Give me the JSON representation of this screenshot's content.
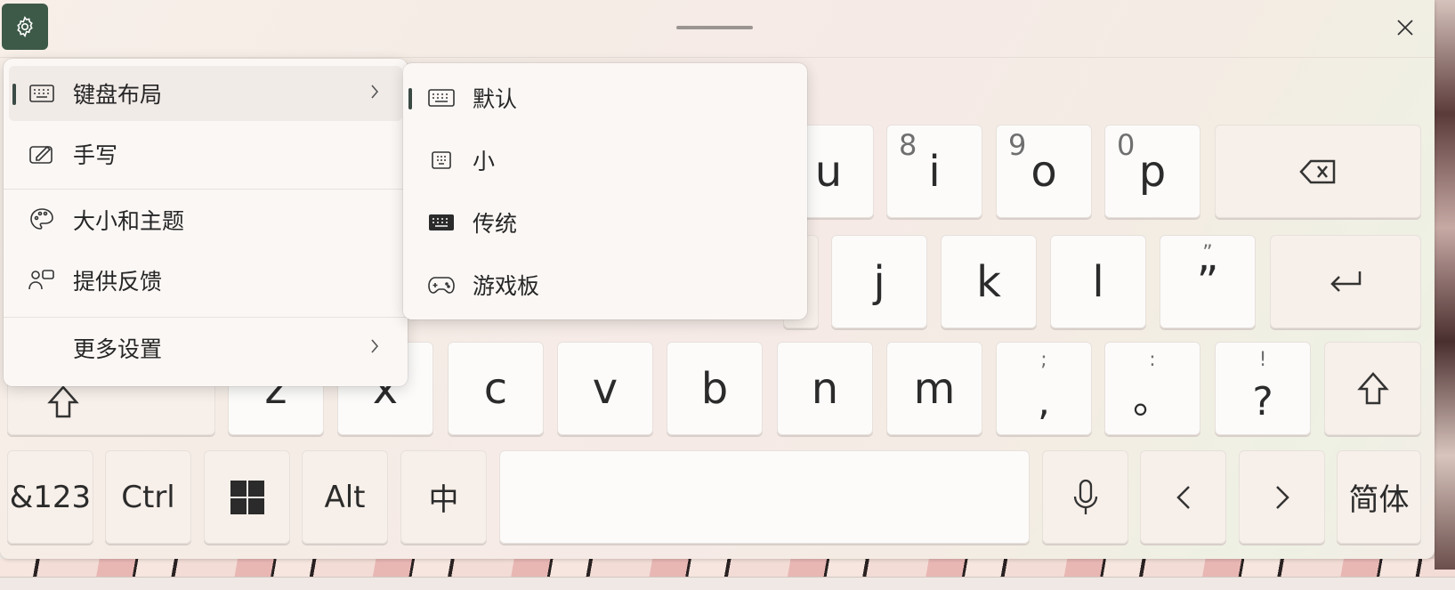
{
  "menu_main": {
    "items": [
      {
        "label": "键盘布局",
        "icon": "keyboard-icon",
        "has_submenu": true,
        "active": true
      },
      {
        "label": "手写",
        "icon": "handwriting-icon"
      },
      {
        "label": "大小和主题",
        "icon": "palette-icon"
      },
      {
        "label": "提供反馈",
        "icon": "feedback-icon"
      },
      {
        "label": "更多设置",
        "icon": "",
        "has_submenu": true
      }
    ]
  },
  "menu_sub": {
    "items": [
      {
        "label": "默认",
        "icon": "keyboard-default-icon",
        "selected": true
      },
      {
        "label": "小",
        "icon": "keyboard-small-icon"
      },
      {
        "label": "传统",
        "icon": "keyboard-traditional-icon"
      },
      {
        "label": "游戏板",
        "icon": "gamepad-icon"
      }
    ]
  },
  "keys": {
    "row1": [
      {
        "main": "u"
      },
      {
        "main": "i",
        "sub": "8"
      },
      {
        "main": "o",
        "sub": "9"
      },
      {
        "main": "p",
        "sub": "0"
      },
      {
        "name": "backspace",
        "icon": "backspace-icon"
      }
    ],
    "row2": [
      {
        "main": "j"
      },
      {
        "main": "k"
      },
      {
        "main": "l"
      },
      {
        "main": "”",
        "top": "”"
      },
      {
        "name": "enter",
        "icon": "enter-icon"
      }
    ],
    "row3": [
      {
        "name": "shift-left",
        "icon": "shift-icon"
      },
      {
        "main": "z"
      },
      {
        "main": "x"
      },
      {
        "main": "c"
      },
      {
        "main": "v"
      },
      {
        "main": "b"
      },
      {
        "main": "n"
      },
      {
        "main": "m"
      },
      {
        "main": ",",
        "top": ";"
      },
      {
        "main": "。",
        "top": ":"
      },
      {
        "main": "?",
        "top": "!"
      },
      {
        "name": "shift-right",
        "icon": "shift-icon"
      }
    ],
    "row4": [
      {
        "label": "&123"
      },
      {
        "label": "Ctrl"
      },
      {
        "name": "windows",
        "icon": "windows-icon"
      },
      {
        "label": "Alt"
      },
      {
        "label": "中"
      },
      {
        "name": "space"
      },
      {
        "name": "microphone",
        "icon": "microphone-icon"
      },
      {
        "name": "left",
        "icon": "chevron-left-icon"
      },
      {
        "name": "right",
        "icon": "chevron-right-icon"
      },
      {
        "label": "简体"
      }
    ]
  },
  "colors": {
    "settings_button_bg": "#3d5a48",
    "key_bg": "#fcfbfa",
    "menu_bg": "#fbf7f5",
    "active_indicator": "#3b4a44"
  }
}
